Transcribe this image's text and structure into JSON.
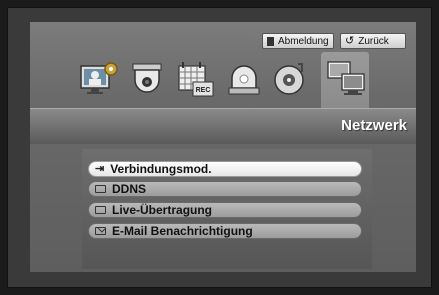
{
  "header": {
    "logout_label": "Abmeldung",
    "back_label": "Zurück",
    "section_title": "Netzwerk"
  },
  "toolbar_icons": [
    {
      "name": "system-settings-icon"
    },
    {
      "name": "camera-dome-icon"
    },
    {
      "name": "record-schedule-icon"
    },
    {
      "name": "alarm-event-icon"
    },
    {
      "name": "backup-disc-icon"
    },
    {
      "name": "network-icon",
      "active": true
    }
  ],
  "menu": {
    "items": [
      {
        "label": "Verbindungsmod.",
        "icon": "connection-icon",
        "selected": true
      },
      {
        "label": "DDNS",
        "icon": "ddns-icon",
        "selected": false
      },
      {
        "label": "Live-Übertragung",
        "icon": "live-stream-icon",
        "selected": false
      },
      {
        "label": "E-Mail Benachrichtigung",
        "icon": "mail-icon",
        "selected": false
      }
    ]
  },
  "colors": {
    "background": "#1b1b1b",
    "panel": "#6a6a6a",
    "selected_item": "#ffffff",
    "item": "#a8a8a8"
  }
}
